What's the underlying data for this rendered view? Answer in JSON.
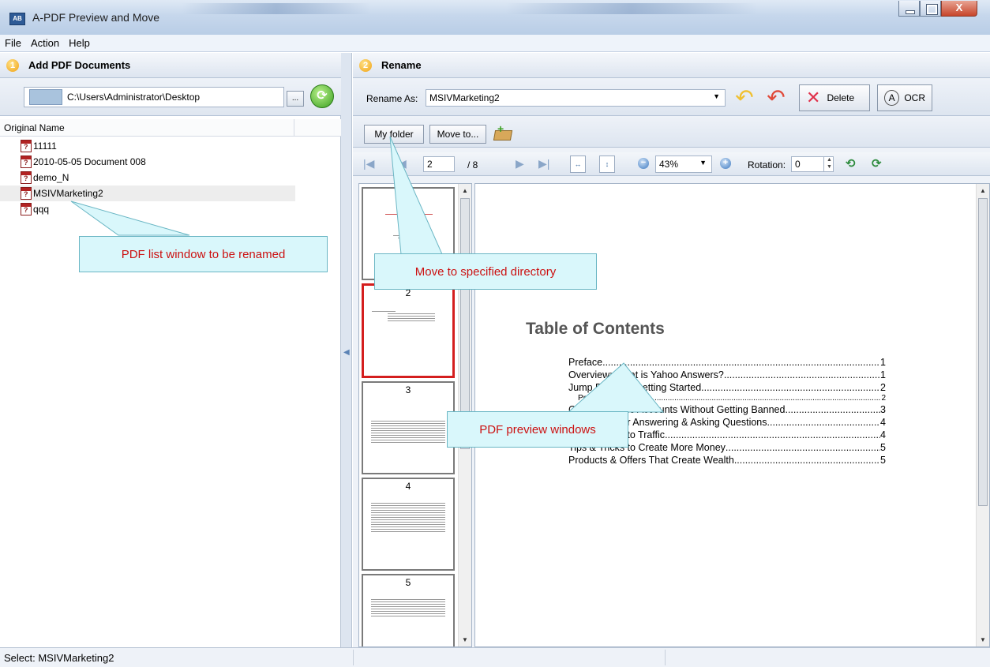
{
  "window": {
    "title": "A-PDF Preview and Move",
    "icon_text": "AB",
    "close_glyph": "X"
  },
  "menu": {
    "file": "File",
    "action": "Action",
    "help": "Help"
  },
  "left_panel": {
    "step_number": "1",
    "header": "Add PDF Documents",
    "path": "C:\\Users\\Administrator\\Desktop",
    "browse_label": "...",
    "column_header": "Original Name",
    "files": [
      {
        "name": "11111"
      },
      {
        "name": "2010-05-05 Document 008"
      },
      {
        "name": "demo_N"
      },
      {
        "name": "MSIVMarketing2"
      },
      {
        "name": "qqq"
      }
    ],
    "selected_file": "MSIVMarketing2"
  },
  "right_panel": {
    "step_number": "2",
    "header": "Rename",
    "rename_as_label": "Rename As:",
    "rename_value": "MSIVMarketing2",
    "delete_label": "Delete",
    "ocr_label": "OCR",
    "my_folder_label": "My folder",
    "move_to_label": "Move to...",
    "current_page": "2",
    "total_pages": "/ 8",
    "zoom": "43%",
    "rotation_label": "Rotation:",
    "rotation_value": "0",
    "thumbnails": [
      "2",
      "3",
      "4",
      "5"
    ],
    "selected_thumbnail": "2"
  },
  "preview": {
    "heading": "Table of Contents",
    "entries": [
      {
        "text": "Preface",
        "page": "1",
        "small": false
      },
      {
        "text": "Overview: What is Yahoo Answers?",
        "page": "1",
        "small": false
      },
      {
        "text": "Jump Right In! Getting Started",
        "page": "2",
        "small": false
      },
      {
        "text": "Products To Sell",
        "page": "2",
        "small": true
      },
      {
        "text": "Create Multiple Accounts Without Getting Banned",
        "page": "3",
        "small": false
      },
      {
        "text": "Strategies For Answering & Asking Questions",
        "page": "4",
        "small": false
      },
      {
        "text": "Converting Into Traffic",
        "page": "4",
        "small": false
      },
      {
        "text": "Tips & Tricks to Create More Money",
        "page": "5",
        "small": false
      },
      {
        "text": "Products & Offers That Create Wealth",
        "page": "5",
        "small": false
      }
    ]
  },
  "status": {
    "text": "Select: MSIVMarketing2"
  },
  "callouts": {
    "list": "PDF list window to be renamed",
    "move": "Move to specified directory",
    "preview": "PDF preview windows"
  }
}
